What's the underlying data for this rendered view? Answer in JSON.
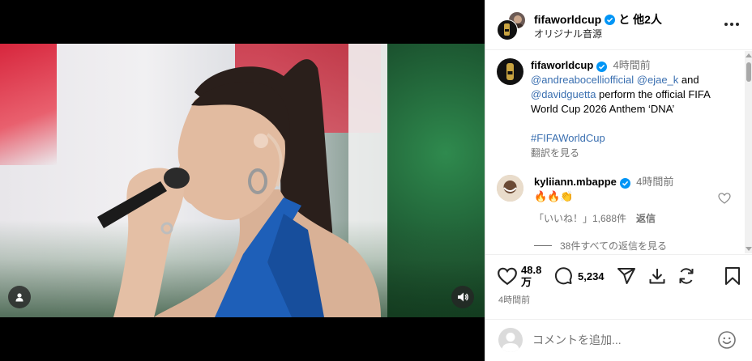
{
  "header": {
    "username": "fifaworldcup",
    "coauthors": "と 他2人",
    "audio": "オリジナル音源"
  },
  "caption": {
    "username": "fifaworldcup",
    "time": "4時間前",
    "mention1": "@andreabocelliofficial",
    "mention2": "@ejae_k",
    "and_word": "and",
    "mention3": "@davidguetta",
    "text": "perform the official FIFA World Cup 2026 Anthem ‘DNA’",
    "hashtag": "#FIFAWorldCup",
    "translate": "翻訳を見る"
  },
  "comment": {
    "username": "kyliiann.mbappe",
    "time": "4時間前",
    "text": "🔥🔥👏",
    "likes": "「いいね！」1,688件",
    "reply": "返信",
    "view_replies": "38件すべての返信を見る"
  },
  "actions": {
    "likes_count_line1": "48.8",
    "likes_count_line2": "万",
    "comments_count": "5,234",
    "post_time": "4時間前"
  },
  "comment_bar": {
    "placeholder": "コメントを追加..."
  },
  "colors": {
    "link": "#3a6fb0",
    "verified": "#0095f6",
    "muted": "#737373"
  },
  "icons": [
    "user-icon",
    "speaker-icon",
    "more-icon",
    "verified-icon",
    "heart-icon",
    "comment-icon",
    "share-icon",
    "save-alt-icon",
    "repost-icon",
    "bookmark-icon",
    "emoji-icon"
  ]
}
